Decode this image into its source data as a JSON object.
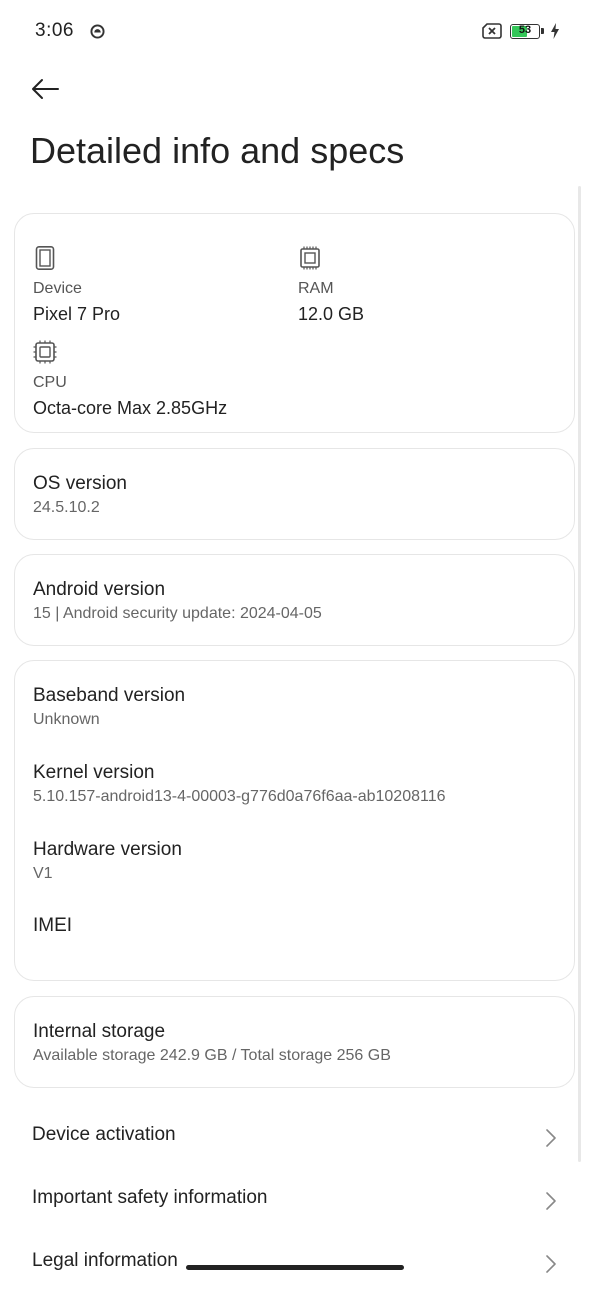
{
  "status": {
    "time": "3:06",
    "battery": "53"
  },
  "page": {
    "title": "Detailed info and specs"
  },
  "specs": {
    "device": {
      "label": "Device",
      "value": "Pixel 7 Pro"
    },
    "ram": {
      "label": "RAM",
      "value": "12.0 GB"
    },
    "cpu": {
      "label": "CPU",
      "value": "Octa-core Max 2.85GHz"
    }
  },
  "os": {
    "title": "OS version",
    "value": "24.5.10.2"
  },
  "android": {
    "title": "Android version",
    "value": "15 | Android security update: 2024-04-05"
  },
  "details": {
    "baseband": {
      "title": "Baseband version",
      "value": "Unknown"
    },
    "kernel": {
      "title": "Kernel version",
      "value": "5.10.157-android13-4-00003-g776d0a76f6aa-ab10208116"
    },
    "hardware": {
      "title": "Hardware version",
      "value": "V1"
    },
    "imei": {
      "title": "IMEI"
    }
  },
  "storage": {
    "title": "Internal storage",
    "value": "Available storage  242.9 GB / Total storage  256 GB"
  },
  "nav": [
    {
      "label": "Device activation"
    },
    {
      "label": "Important safety information"
    },
    {
      "label": "Legal information"
    }
  ]
}
